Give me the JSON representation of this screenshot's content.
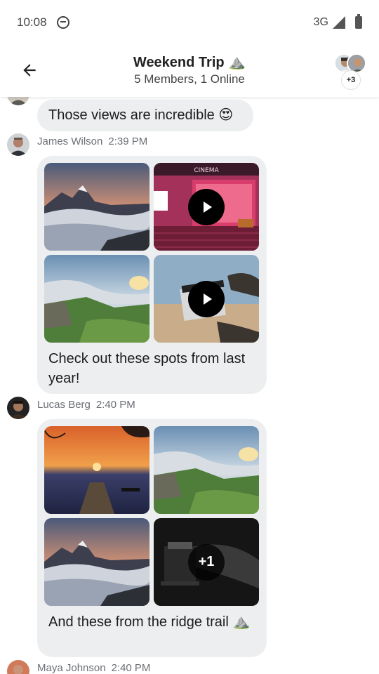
{
  "status_bar": {
    "time": "10:08",
    "network": "3G"
  },
  "header": {
    "title": "Weekend Trip ⛰️",
    "subtitle": "5 Members, 1 Online",
    "extra_members": "+3"
  },
  "messages": [
    {
      "text": "Those views are incredible 😍"
    },
    {
      "sender": "James Wilson",
      "time": "2:39 PM",
      "text": "Check out these spots from last year!",
      "tiles": [
        {
          "kind": "image",
          "scene": "mountain-clouds"
        },
        {
          "kind": "video",
          "scene": "cinema",
          "sign": "CINEMA"
        },
        {
          "kind": "image",
          "scene": "green-cliffs"
        },
        {
          "kind": "video",
          "scene": "clapperboard"
        }
      ]
    },
    {
      "sender": "Lucas Berg",
      "time": "2:40 PM",
      "text": "And these from the ridge trail ⛰️",
      "tiles": [
        {
          "kind": "image",
          "scene": "sunset-pier"
        },
        {
          "kind": "image",
          "scene": "green-cliffs"
        },
        {
          "kind": "image",
          "scene": "mountain-clouds"
        },
        {
          "kind": "more",
          "scene": "projector",
          "more_label": "+1"
        }
      ]
    },
    {
      "sender": "Maya Johnson",
      "time": "2:40 PM"
    }
  ],
  "colors": {
    "bubble": "#eceef0",
    "meta": "#6c6f75"
  }
}
